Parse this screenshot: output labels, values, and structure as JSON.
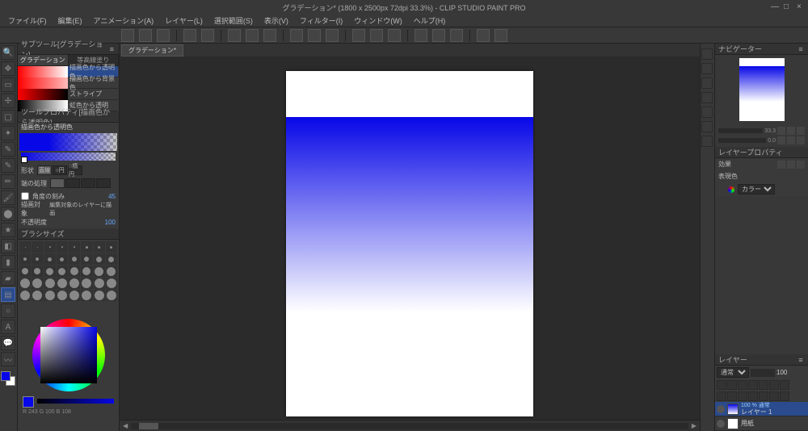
{
  "title": "グラデーション* (1800 x 2500px 72dpi 33.3%)    - CLIP STUDIO PAINT PRO",
  "menu": [
    "ファイル(F)",
    "編集(E)",
    "アニメーション(A)",
    "レイヤー(L)",
    "選択範囲(S)",
    "表示(V)",
    "フィルター(I)",
    "ウィンドウ(W)",
    "ヘルプ(H)"
  ],
  "subtool": {
    "header": "サブツール[グラデーション]",
    "tabs": [
      "グラデーション",
      "等高線塗り"
    ],
    "presets": [
      "描画色から透明色",
      "描画色から背景色",
      "ストライプ",
      "虹色から透明"
    ],
    "selected": 0
  },
  "toolprop": {
    "header": "ツールプロパティ[描画色から透明色]",
    "title": "描画色から透明色",
    "shape_label": "形状",
    "shape_opts": [
      "直線",
      "○円",
      "○楕円"
    ],
    "edge_label": "端の処理",
    "angle_label": "角度の刻み",
    "angle_val": "45",
    "target_label": "描画対象",
    "target_val": "編集対象のレイヤーに描画",
    "opacity_label": "不透明度",
    "opacity_val": "100"
  },
  "brushsize": {
    "header": "ブラシサイズ"
  },
  "colorreadout": "R 243 G 100 B 108",
  "doc_tab": "グラデーション*",
  "navigator": {
    "header": "ナビゲーター",
    "zoom": "33.3",
    "angle": "0.0"
  },
  "layerprop": {
    "header": "レイヤープロパティ",
    "effect": "効果",
    "mode_label": "表現色",
    "mode_val": "カラー"
  },
  "layers": {
    "header": "レイヤー",
    "blend": "通常",
    "opacity": "100",
    "items": [
      {
        "name": "レイヤー 1",
        "top": "100 % 通常",
        "kind": "grad"
      },
      {
        "name": "用紙",
        "top": "",
        "kind": "paper"
      }
    ]
  }
}
